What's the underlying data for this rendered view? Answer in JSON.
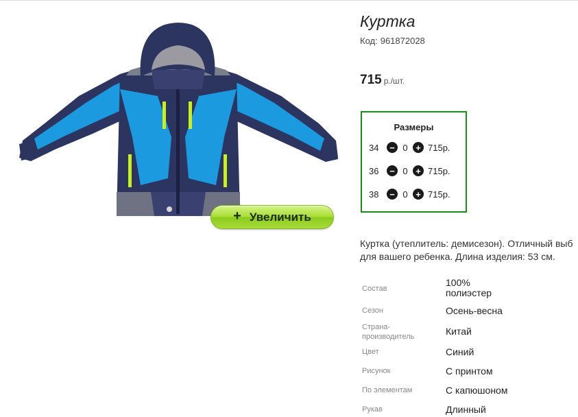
{
  "product": {
    "title": "Куртка",
    "code_label": "Код:",
    "code_value": "961872028",
    "price_value": "715",
    "price_unit": "р./шт.",
    "zoom_button_label": "Увеличить"
  },
  "sizes": {
    "title": "Размеры",
    "rows": [
      {
        "size": "34",
        "qty": "0",
        "price": "715р."
      },
      {
        "size": "36",
        "qty": "0",
        "price": "715р."
      },
      {
        "size": "38",
        "qty": "0",
        "price": "715р."
      }
    ]
  },
  "description": {
    "line1": "Куртка (утеплитель: демисезон). Отличный выб",
    "line2": "для вашего ребенка. Длина изделия: 53 см."
  },
  "specs": [
    {
      "label": "Состав",
      "value": "100%\nполиэстер"
    },
    {
      "label": "Сезон",
      "value": "Осень-весна"
    },
    {
      "label": "Страна-\nпроизводитель",
      "value": "Китай"
    },
    {
      "label": "Цвет",
      "value": "Синий"
    },
    {
      "label": "Рисунок",
      "value": "С принтом"
    },
    {
      "label": "По элементам",
      "value": "С капюшоном"
    },
    {
      "label": "Рукав",
      "value": "Длинный"
    }
  ],
  "colors": {
    "accent_green": "#1a8c1a",
    "button_green": "#a9dd35",
    "jacket_navy": "#2c3460",
    "jacket_blue": "#1b9ae0",
    "zipper_lime": "#c8f01e"
  }
}
